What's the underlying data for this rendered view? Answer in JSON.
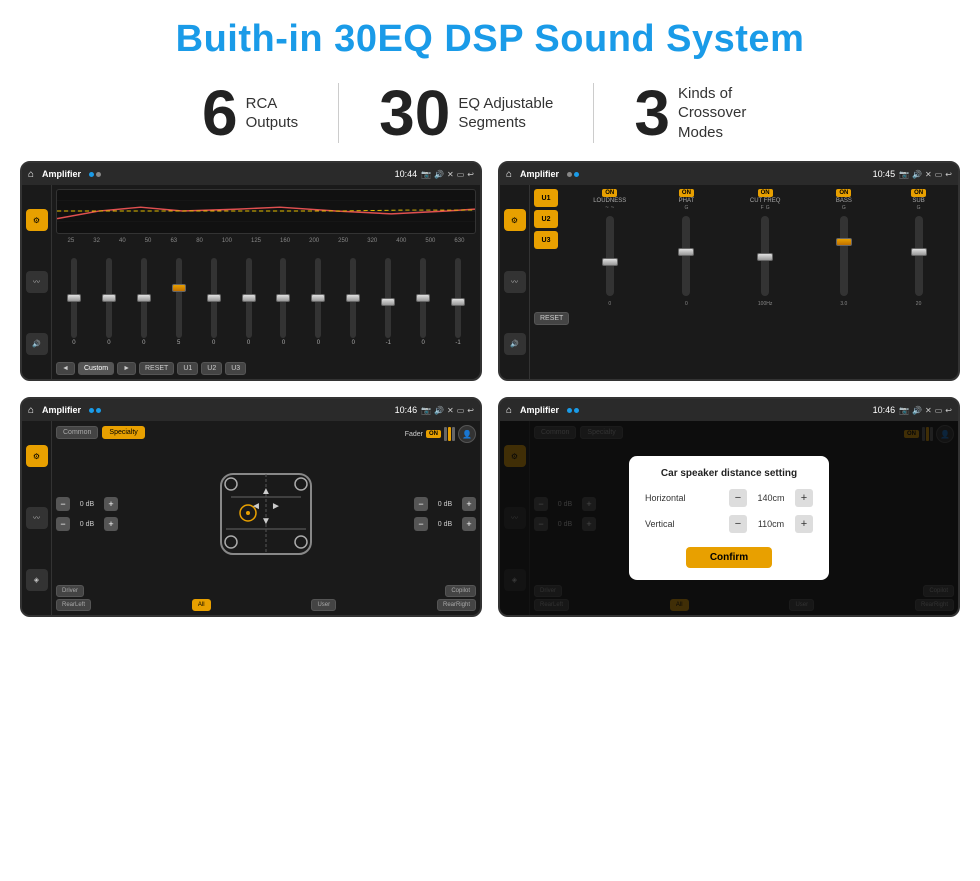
{
  "title": "Buith-in 30EQ DSP Sound System",
  "stats": [
    {
      "number": "6",
      "label": "RCA\nOutputs"
    },
    {
      "number": "30",
      "label": "EQ Adjustable\nSegments"
    },
    {
      "number": "3",
      "label": "Kinds of\nCrossover Modes"
    }
  ],
  "screens": [
    {
      "id": "screen1",
      "app": "Amplifier",
      "time": "10:44",
      "type": "eq",
      "freq_labels": [
        "25",
        "32",
        "40",
        "50",
        "63",
        "80",
        "100",
        "125",
        "160",
        "200",
        "250",
        "320",
        "400",
        "500",
        "630"
      ],
      "sliders": [
        {
          "pos": 50,
          "val": "0"
        },
        {
          "pos": 50,
          "val": "0"
        },
        {
          "pos": 50,
          "val": "0"
        },
        {
          "pos": 45,
          "val": "5"
        },
        {
          "pos": 50,
          "val": "0"
        },
        {
          "pos": 50,
          "val": "0"
        },
        {
          "pos": 50,
          "val": "0"
        },
        {
          "pos": 50,
          "val": "0"
        },
        {
          "pos": 50,
          "val": "0"
        },
        {
          "pos": 55,
          "val": "-1"
        },
        {
          "pos": 50,
          "val": "0"
        },
        {
          "pos": 55,
          "val": "-1"
        }
      ],
      "bottom_btns": [
        "◄",
        "Custom",
        "►",
        "RESET",
        "U1",
        "U2",
        "U3"
      ]
    },
    {
      "id": "screen2",
      "app": "Amplifier",
      "time": "10:45",
      "type": "crossover",
      "presets": [
        "U1",
        "U2",
        "U3"
      ],
      "channels": [
        {
          "label": "LOUDNESS",
          "on": true
        },
        {
          "label": "PHAT",
          "on": true
        },
        {
          "label": "CUT FREQ",
          "on": true
        },
        {
          "label": "BASS",
          "on": true
        },
        {
          "label": "SUB",
          "on": true
        }
      ],
      "reset_label": "RESET"
    },
    {
      "id": "screen3",
      "app": "Amplifier",
      "time": "10:46",
      "type": "mapping",
      "tabs": [
        "Common",
        "Specialty"
      ],
      "fader_label": "Fader",
      "fader_on": true,
      "speakers": [
        {
          "val": "0 dB"
        },
        {
          "val": "0 dB"
        },
        {
          "val": "0 dB"
        },
        {
          "val": "0 dB"
        }
      ],
      "bottom_btns": [
        {
          "label": "Driver",
          "active": false
        },
        {
          "label": "Copilot",
          "active": false
        },
        {
          "label": "RearLeft",
          "active": false
        },
        {
          "label": "All",
          "active": true
        },
        {
          "label": "User",
          "active": false
        },
        {
          "label": "RearRight",
          "active": false
        }
      ]
    },
    {
      "id": "screen4",
      "app": "Amplifier",
      "time": "10:46",
      "type": "distance",
      "tabs": [
        "Common",
        "Specialty"
      ],
      "modal": {
        "title": "Car speaker distance setting",
        "horizontal_label": "Horizontal",
        "horizontal_val": "140cm",
        "vertical_label": "Vertical",
        "vertical_val": "110cm",
        "confirm_label": "Confirm"
      },
      "speakers": [
        {
          "val": "0 dB"
        },
        {
          "val": "0 dB"
        }
      ],
      "bottom_btns": [
        {
          "label": "Driver",
          "active": false
        },
        {
          "label": "Copilot",
          "active": false
        },
        {
          "label": "RearLeft",
          "active": false
        },
        {
          "label": "All",
          "active": true
        },
        {
          "label": "User",
          "active": false
        },
        {
          "label": "RearRight",
          "active": false
        }
      ]
    }
  ]
}
